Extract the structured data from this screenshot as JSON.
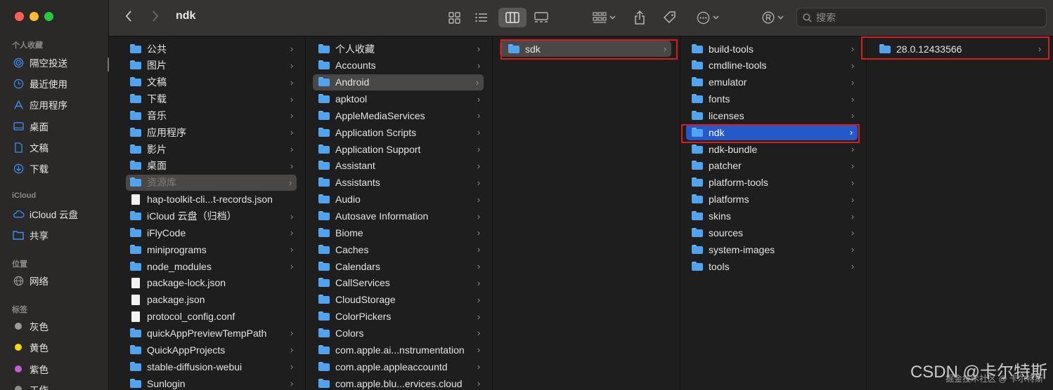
{
  "window": {
    "title": "ndk",
    "search_placeholder": "搜索"
  },
  "sidebar": {
    "sections": [
      {
        "label": "个人收藏",
        "items": [
          {
            "label": "隔空投送",
            "icon": "airdrop-icon"
          },
          {
            "label": "最近使用",
            "icon": "clock-icon"
          },
          {
            "label": "应用程序",
            "icon": "apps-icon"
          },
          {
            "label": "桌面",
            "icon": "desktop-icon"
          },
          {
            "label": "文稿",
            "icon": "document-icon"
          },
          {
            "label": "下载",
            "icon": "download-icon"
          }
        ]
      },
      {
        "label": "iCloud",
        "items": [
          {
            "label": "iCloud 云盘",
            "icon": "cloud-icon"
          },
          {
            "label": "共享",
            "icon": "shared-folder-icon"
          }
        ]
      },
      {
        "label": "位置",
        "items": [
          {
            "label": "网络",
            "icon": "network-icon"
          }
        ]
      },
      {
        "label": "标签",
        "items": [
          {
            "label": "灰色",
            "color": "#9b9b9b"
          },
          {
            "label": "黄色",
            "color": "#f5d80d"
          },
          {
            "label": "紫色",
            "color": "#c85bd9"
          },
          {
            "label": "工作",
            "color": "#8e8e8e"
          }
        ]
      }
    ]
  },
  "columns": [
    {
      "name": "home",
      "items": [
        {
          "label": "公共",
          "type": "folder"
        },
        {
          "label": "图片",
          "type": "folder"
        },
        {
          "label": "文稿",
          "type": "folder"
        },
        {
          "label": "下载",
          "type": "folder"
        },
        {
          "label": "音乐",
          "type": "folder"
        },
        {
          "label": "应用程序",
          "type": "folder"
        },
        {
          "label": "影片",
          "type": "folder"
        },
        {
          "label": "桌面",
          "type": "folder"
        },
        {
          "label": "资源库",
          "type": "folder",
          "state": "selected-dim"
        },
        {
          "label": "hap-toolkit-cli...t-records.json",
          "type": "file"
        },
        {
          "label": "iCloud 云盘（归档）",
          "type": "folder"
        },
        {
          "label": "iFlyCode",
          "type": "folder"
        },
        {
          "label": "miniprograms",
          "type": "folder"
        },
        {
          "label": "node_modules",
          "type": "folder"
        },
        {
          "label": "package-lock.json",
          "type": "file"
        },
        {
          "label": "package.json",
          "type": "file"
        },
        {
          "label": "protocol_config.conf",
          "type": "file"
        },
        {
          "label": "quickAppPreviewTempPath",
          "type": "folder"
        },
        {
          "label": "QuickAppProjects",
          "type": "folder"
        },
        {
          "label": "stable-diffusion-webui",
          "type": "folder"
        },
        {
          "label": "Sunlogin",
          "type": "folder"
        }
      ]
    },
    {
      "name": "library",
      "items": [
        {
          "label": "个人收藏",
          "type": "folder"
        },
        {
          "label": "Accounts",
          "type": "folder"
        },
        {
          "label": "Android",
          "type": "folder",
          "state": "selected"
        },
        {
          "label": "apktool",
          "type": "folder"
        },
        {
          "label": "AppleMediaServices",
          "type": "folder"
        },
        {
          "label": "Application Scripts",
          "type": "folder"
        },
        {
          "label": "Application Support",
          "type": "folder"
        },
        {
          "label": "Assistant",
          "type": "folder"
        },
        {
          "label": "Assistants",
          "type": "folder"
        },
        {
          "label": "Audio",
          "type": "folder"
        },
        {
          "label": "Autosave Information",
          "type": "folder"
        },
        {
          "label": "Biome",
          "type": "folder"
        },
        {
          "label": "Caches",
          "type": "folder"
        },
        {
          "label": "Calendars",
          "type": "folder"
        },
        {
          "label": "CallServices",
          "type": "folder"
        },
        {
          "label": "CloudStorage",
          "type": "folder"
        },
        {
          "label": "ColorPickers",
          "type": "folder"
        },
        {
          "label": "Colors",
          "type": "folder"
        },
        {
          "label": "com.apple.ai...nstrumentation",
          "type": "folder"
        },
        {
          "label": "com.apple.appleaccountd",
          "type": "folder"
        },
        {
          "label": "com.apple.blu...ervices.cloud",
          "type": "folder"
        }
      ]
    },
    {
      "name": "android",
      "items": [
        {
          "label": "sdk",
          "type": "folder",
          "state": "selected"
        }
      ]
    },
    {
      "name": "sdk",
      "items": [
        {
          "label": "build-tools",
          "type": "folder"
        },
        {
          "label": "cmdline-tools",
          "type": "folder"
        },
        {
          "label": "emulator",
          "type": "folder"
        },
        {
          "label": "fonts",
          "type": "folder"
        },
        {
          "label": "licenses",
          "type": "folder"
        },
        {
          "label": "ndk",
          "type": "folder",
          "state": "active"
        },
        {
          "label": "ndk-bundle",
          "type": "folder"
        },
        {
          "label": "patcher",
          "type": "folder"
        },
        {
          "label": "platform-tools",
          "type": "folder"
        },
        {
          "label": "platforms",
          "type": "folder"
        },
        {
          "label": "skins",
          "type": "folder"
        },
        {
          "label": "sources",
          "type": "folder"
        },
        {
          "label": "system-images",
          "type": "folder"
        },
        {
          "label": "tools",
          "type": "folder"
        }
      ]
    },
    {
      "name": "ndk",
      "items": [
        {
          "label": "28.0.12433566",
          "type": "folder"
        }
      ]
    }
  ],
  "watermark": {
    "main": "CSDN @卡尔特斯",
    "sub": "掘金技术社区 @ 卡尔特斯"
  },
  "colors": {
    "selection_blue": "#2459c7",
    "highlight_red": "#d91c1c",
    "folder_blue": "#4fa3ef"
  }
}
